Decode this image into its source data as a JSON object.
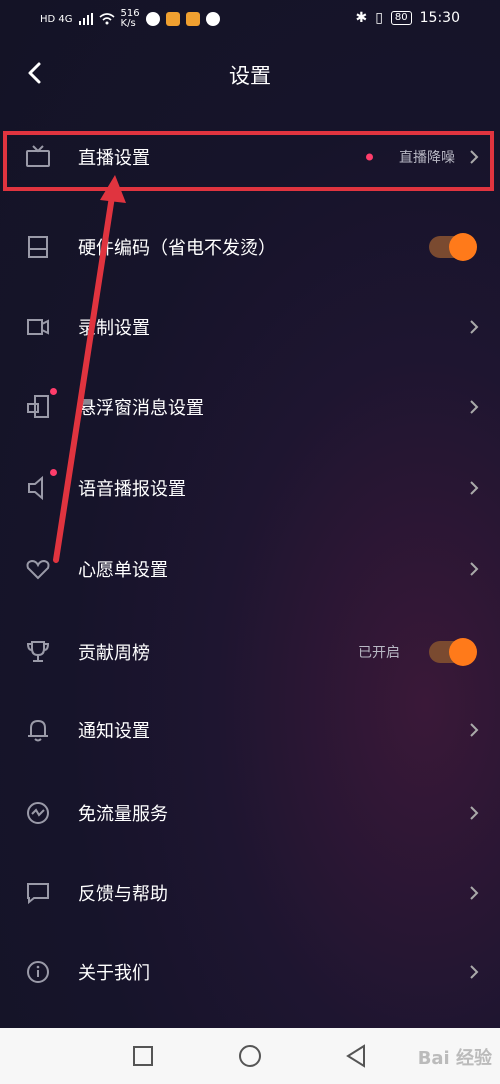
{
  "status_bar": {
    "network": "HD 4G",
    "speed": "516\nK/s",
    "battery": "80",
    "time": "15:30"
  },
  "header": {
    "title": "设置"
  },
  "settings": [
    {
      "label": "直播设置",
      "value": "直播降噪",
      "icon": "tv-icon",
      "has_dot": true
    },
    {
      "label": "硬件编码（省电不发烫）",
      "icon": "panel-icon",
      "toggle": true
    },
    {
      "label": "录制设置",
      "icon": "record-icon"
    },
    {
      "label": "悬浮窗消息设置",
      "icon": "floating-window-icon",
      "icon_dot": true
    },
    {
      "label": "语音播报设置",
      "icon": "speaker-icon",
      "icon_dot": true
    },
    {
      "label": "心愿单设置",
      "icon": "heart-icon"
    },
    {
      "label": "贡献周榜",
      "value": "已开启",
      "icon": "trophy-icon",
      "toggle": true
    },
    {
      "label": "通知设置",
      "icon": "bell-icon"
    },
    {
      "label": "免流量服务",
      "icon": "traffic-icon"
    },
    {
      "label": "反馈与帮助",
      "icon": "feedback-icon"
    },
    {
      "label": "关于我们",
      "icon": "info-icon"
    }
  ],
  "watermark": "Bai 经验",
  "colors": {
    "accent": "#ff7a1a",
    "dot": "#ff3d6b",
    "highlight": "#e0343f"
  }
}
